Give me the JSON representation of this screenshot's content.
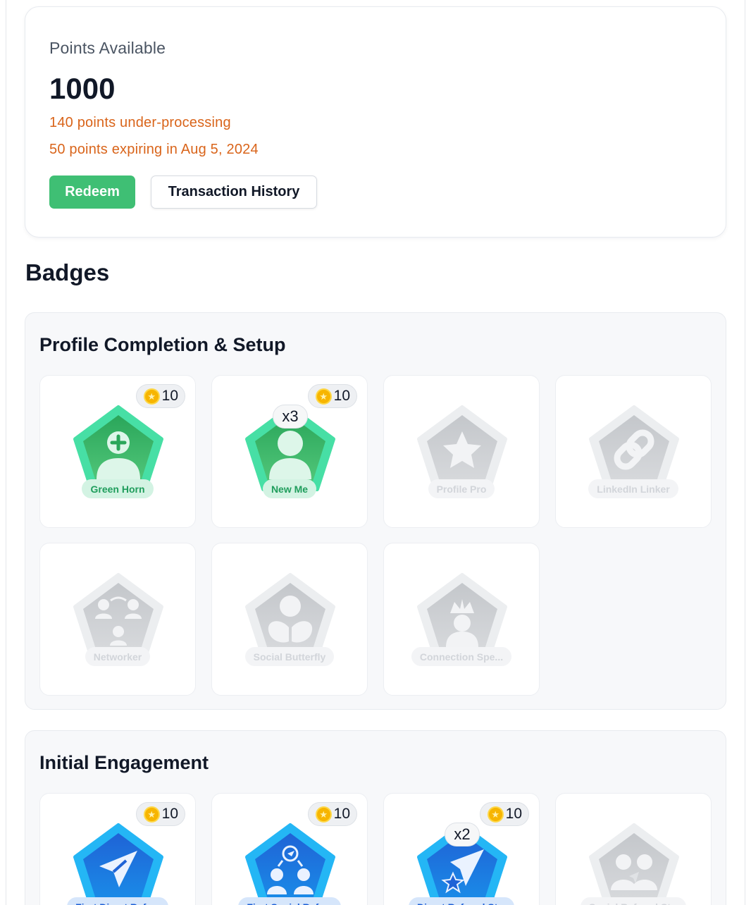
{
  "points": {
    "label": "Points Available",
    "value": "1000",
    "processing": "140 points under-processing",
    "expiring": "50 points expiring in Aug 5, 2024",
    "redeem_label": "Redeem",
    "history_label": "Transaction History"
  },
  "badges_title": "Badges",
  "colors": {
    "earned_green": "#3fbf74",
    "earned_blue": "#1d6fe0",
    "locked_gray": "#cfd2d6",
    "warning_orange": "#d9641a"
  },
  "sections": [
    {
      "title": "Profile Completion & Setup",
      "badges": [
        {
          "name": "Green Horn",
          "points": "10",
          "multiplier": "",
          "icon": "user-plus-icon",
          "state": "earned"
        },
        {
          "name": "New Me",
          "points": "10",
          "multiplier": "x3",
          "icon": "user-icon",
          "state": "earned"
        },
        {
          "name": "Profile Pro",
          "points": "",
          "multiplier": "",
          "icon": "star-icon",
          "state": "locked"
        },
        {
          "name": "LinkedIn Linker",
          "points": "",
          "multiplier": "",
          "icon": "link-icon",
          "state": "locked"
        },
        {
          "name": "Networker",
          "points": "",
          "multiplier": "",
          "icon": "network-icon",
          "state": "locked"
        },
        {
          "name": "Social Butterfly",
          "points": "",
          "multiplier": "",
          "icon": "butterfly-icon",
          "state": "locked"
        },
        {
          "name": "Connection Spe...",
          "points": "",
          "multiplier": "",
          "icon": "crown-icon",
          "state": "locked"
        }
      ]
    },
    {
      "title": "Initial Engagement",
      "badges": [
        {
          "name": "First Direct Refe...",
          "points": "10",
          "multiplier": "",
          "icon": "send-icon",
          "state": "earned"
        },
        {
          "name": "First Social Refe...",
          "points": "10",
          "multiplier": "",
          "icon": "social-referral-icon",
          "state": "earned"
        },
        {
          "name": "Direct Referral Star",
          "points": "10",
          "multiplier": "x2",
          "icon": "send-star-icon",
          "state": "earned"
        },
        {
          "name": "Social Referral St...",
          "points": "",
          "multiplier": "",
          "icon": "group-send-icon",
          "state": "locked"
        }
      ]
    }
  ]
}
